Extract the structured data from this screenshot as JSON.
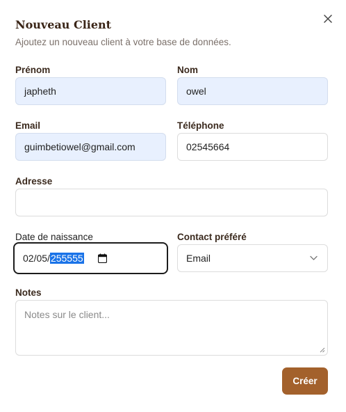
{
  "dialog": {
    "title": "Nouveau Client",
    "subtitle": "Ajoutez un nouveau client à votre base de données."
  },
  "form": {
    "first_name": {
      "label": "Prénom",
      "value": "japheth"
    },
    "last_name": {
      "label": "Nom",
      "value": "owel"
    },
    "email": {
      "label": "Email",
      "value": "guimbetiowel@gmail.com"
    },
    "phone": {
      "label": "Téléphone",
      "value": "02545664"
    },
    "address": {
      "label": "Adresse",
      "value": ""
    },
    "birthdate": {
      "label": "Date de naissance",
      "value_prefix": "02/05/",
      "value_selected": "255555"
    },
    "contact": {
      "label": "Contact préféré",
      "value": "Email"
    },
    "notes": {
      "label": "Notes",
      "placeholder": "Notes sur le client..."
    }
  },
  "actions": {
    "submit_label": "Créer"
  },
  "icons": {
    "close": "close-icon",
    "calendar": "calendar-icon",
    "chevron": "chevron-down-icon"
  },
  "colors": {
    "primary_button": "#a3612c",
    "autofill_bg": "#e8f0fe",
    "selection": "#1a73e8"
  }
}
